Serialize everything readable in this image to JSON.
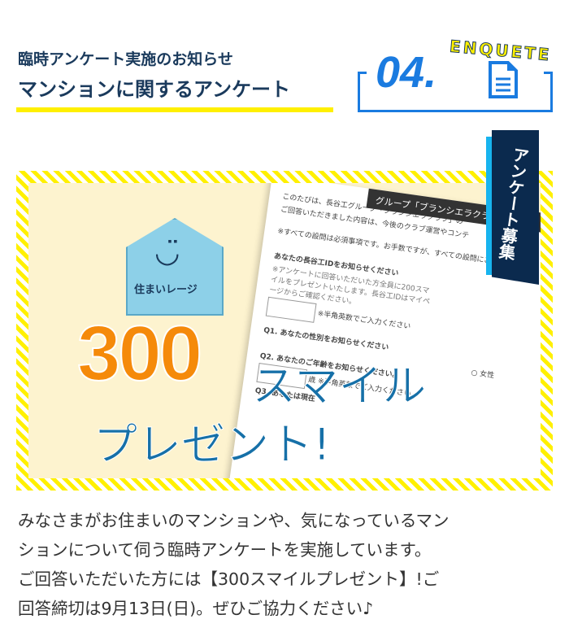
{
  "header": {
    "subtitle": "臨時アンケート実施のお知らせ",
    "title": "マンションに関するアンケート"
  },
  "badge": {
    "number": "04.",
    "label": "ENQUETE"
  },
  "banner": {
    "ribbon": "アンケート募集",
    "tag_label": "住まいレージ",
    "headline_number": "300",
    "headline_text": "スマイル",
    "headline_sub": "プレゼント!",
    "form": {
      "header": "グループ「ブランシエラクラブ」",
      "intro1": "このたびは、長谷工グループ「ブランシエラクラブ」の",
      "intro2": "ご回答いただきました内容は、今後のクラブ運営やコンテ",
      "notice": "※すべての設問は必須事項です。お手数ですが、すべての設問にご回答くだ",
      "q_id": "あなたの長谷工IDをお知らせください",
      "q_id_note": "※アンケートに回答いただいた方全員に200スマイルをプレゼントいたします。長谷工IDはマイページからご確認ください。",
      "half_width": "※半角英数でご入力ください",
      "q1": "Q1. あなたの性別をお知らせください",
      "female": "女性",
      "q2": "Q2. あなたのご年齢をお知らせください。",
      "age_unit": "歳",
      "q3": "Q3. あなたは現在"
    }
  },
  "description": [
    "みなさまがお住まいのマンションや、気になっているマン",
    "ションについて伺う臨時アンケートを実施しています。",
    "ご回答いただいた方には【300スマイルプレゼント】!ご",
    "回答締切は9月13日(日)。ぜひご協力ください♪"
  ]
}
